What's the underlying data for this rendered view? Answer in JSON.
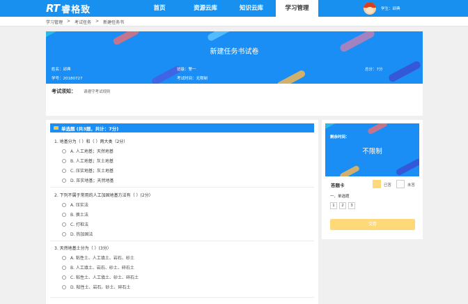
{
  "nav": {
    "logo_mark": "RT",
    "logo_name": "睿格致",
    "items": [
      {
        "label": "首页"
      },
      {
        "label": "资源云库"
      },
      {
        "label": "知识云库"
      },
      {
        "label": "学习管理"
      }
    ],
    "user_label": "学生：邱典"
  },
  "breadcrumb": [
    "学习管理",
    ">",
    "考试任务",
    ">",
    "新建任务书"
  ],
  "banner": {
    "title": "新建任务书试卷",
    "name": "姓名：邱典",
    "student_id": "学号：20180727",
    "class": "班级：警一",
    "exam_time": "考试时间：无限制",
    "total_score": "总分：7分"
  },
  "notice": {
    "label": "考试须知：",
    "text": "请遵守考试规则"
  },
  "section": {
    "title": "单选题 (共3题，共计：7分)"
  },
  "questions": [
    {
      "text": "1. 地基分为（ ）和（ ）两大类（2分）",
      "options": [
        "A. 人工地基；天然地基",
        "B. 人工地基；灰土地基",
        "C. 压实地基；灰土地基",
        "D. 压实地基；天然地基"
      ]
    },
    {
      "text": "2. 下列不属于常用的人工加固地基方法有（ ）(2分）",
      "options": [
        "A. 压实法",
        "B. 换土法",
        "C. 打桩法",
        "D. 热加固法"
      ]
    },
    {
      "text": "3. 天然地基土分为（ ）(3分）",
      "options": [
        "A. 粘性土、人工填土、岩石、砂土",
        "B. 人工填土、岩石、砂土、碎石土",
        "C. 粘性土、人工填土、砂土、碎石土",
        "D. 粘性土、岩石、砂土、碎石土"
      ]
    }
  ],
  "sidebar": {
    "timer_label": "剩余时间：",
    "timer_value": "不限制",
    "card_title": "答题卡",
    "answered_label": "已答",
    "unanswered_label": "未答",
    "group_title": "一、单选题",
    "numbers": [
      "1",
      "2",
      "3"
    ],
    "submit_label": "交卷"
  },
  "colors": {
    "primary": "#1890f0",
    "answered": "#fdd97a",
    "submit": "#fdd97a"
  }
}
